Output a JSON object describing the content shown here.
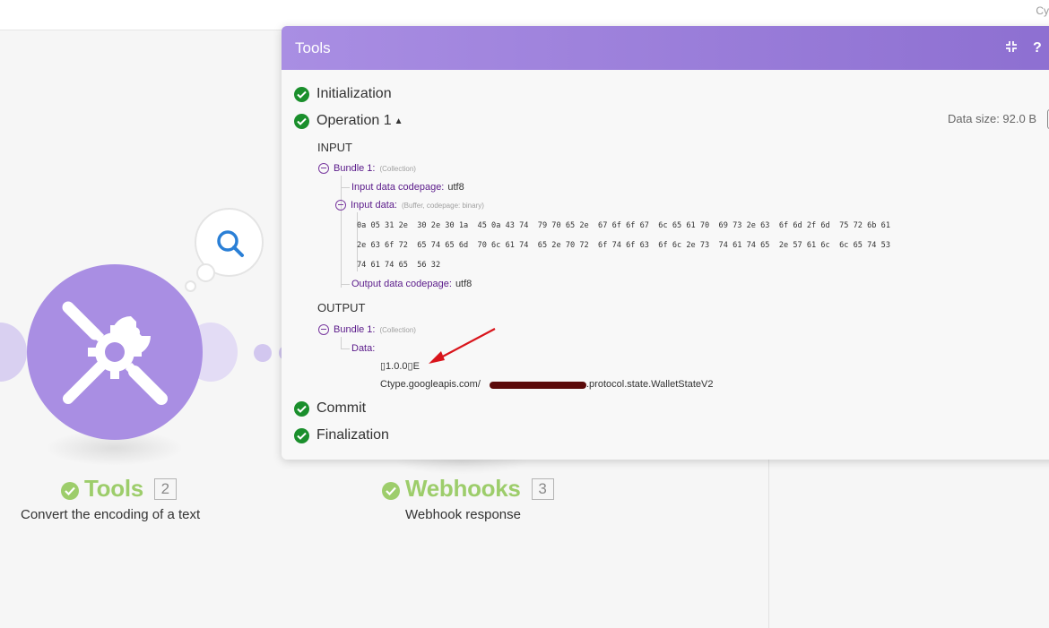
{
  "topbar": {
    "corner_text": "Cy"
  },
  "modules": {
    "tools": {
      "title": "Tools",
      "number": "2",
      "subtitle": "Convert the encoding of a text"
    },
    "webhooks": {
      "title": "Webhooks",
      "number": "3",
      "subtitle": "Webhook response"
    }
  },
  "panel": {
    "title": "Tools",
    "icons": {
      "collapse": "collapse-icon",
      "help": "?"
    },
    "steps": {
      "initialization": "Initialization",
      "operation": "Operation 1",
      "commit": "Commit",
      "finalization": "Finalization"
    },
    "data_size": "Data size: 92.0 B",
    "input": {
      "label": "INPUT",
      "bundle": {
        "name": "Bundle 1:",
        "hint": "(Collection)"
      },
      "codepage": {
        "key": "Input data codepage:",
        "value": "utf8"
      },
      "data": {
        "key": "Input data:",
        "hint": "(Buffer, codepage: binary)"
      },
      "hex_lines": [
        "0a 05 31 2e  30 2e 30 1a  45 0a 43 74  79 70 65 2e  67 6f 6f 67  6c 65 61 70  69 73 2e 63  6f 6d 2f 6d  75 72 6b 61",
        "2e 63 6f 72  65 74 65 6d  70 6c 61 74  65 2e 70 72  6f 74 6f 63  6f 6c 2e 73  74 61 74 65  2e 57 61 6c  6c 65 74 53",
        "74 61 74 65  56 32"
      ],
      "output_codepage": {
        "key": "Output data codepage:",
        "value": "utf8"
      }
    },
    "output": {
      "label": "OUTPUT",
      "bundle": {
        "name": "Bundle 1:",
        "hint": "(Collection)"
      },
      "data_key": "Data:",
      "line1": "▯1.0.0▯E",
      "line2_start": "Ctype.googleapis.com/",
      "line2_end": ".protocol.state.WalletStateV2"
    }
  },
  "colors": {
    "accent": "#a98ee3",
    "success": "#1a8f2c",
    "module_title": "#9dcd6b",
    "annotation_arrow": "#d9141b"
  }
}
